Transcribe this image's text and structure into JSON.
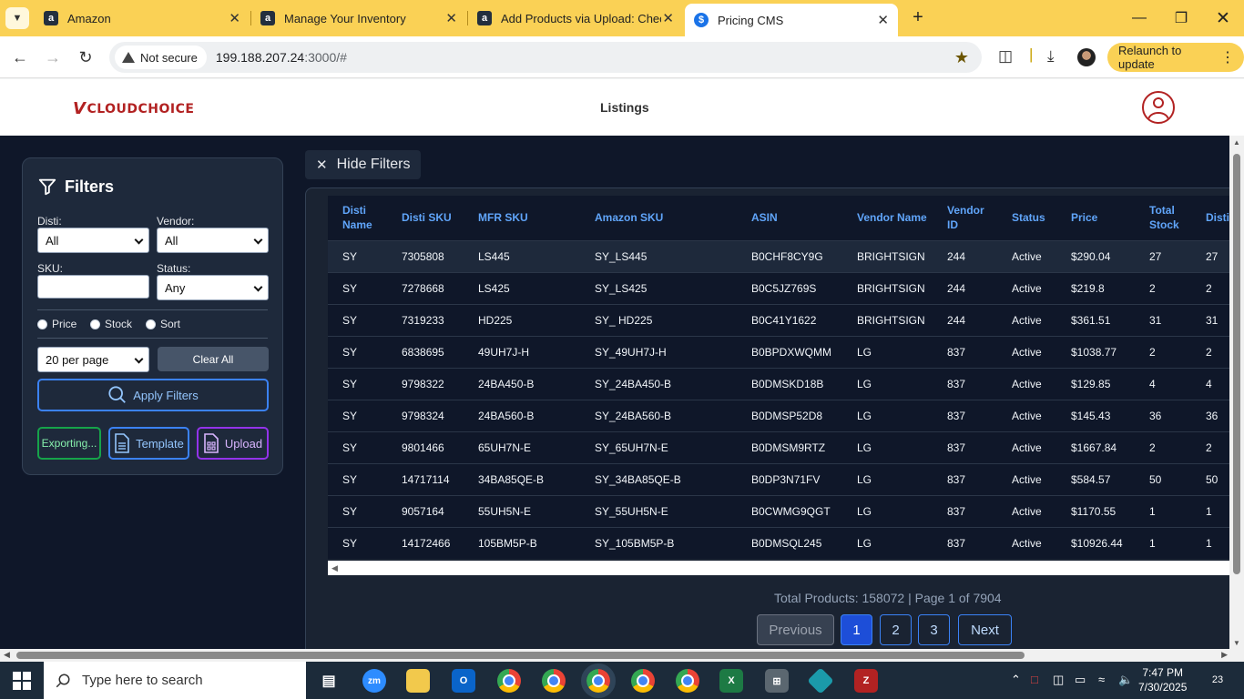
{
  "browser": {
    "tabs": [
      {
        "title": "Amazon"
      },
      {
        "title": "Manage Your Inventory"
      },
      {
        "title": "Add Products via Upload: Check"
      },
      {
        "title": "Pricing CMS"
      }
    ],
    "security_label": "Not secure",
    "url_host": "199.188.207.24",
    "url_path": ":3000/#",
    "relaunch_label": "Relaunch to update"
  },
  "header": {
    "logo_text": "CLOUDCHOICE",
    "nav_title": "Listings"
  },
  "filters": {
    "title": "Filters",
    "disti_label": "Disti:",
    "disti_value": "All",
    "vendor_label": "Vendor:",
    "vendor_value": "All",
    "sku_label": "SKU:",
    "status_label": "Status:",
    "status_value": "Any",
    "radio_price": "Price",
    "radio_stock": "Stock",
    "radio_sort": "Sort",
    "per_page_value": "20 per page",
    "clear_all_label": "Clear All",
    "apply_label": "Apply Filters",
    "export_label": "Exporting...",
    "template_label": "Template",
    "upload_label": "Upload"
  },
  "hide_filters_label": "Hide Filters",
  "table": {
    "columns": [
      "Disti Name",
      "Disti SKU",
      "MFR SKU",
      "Amazon SKU",
      "ASIN",
      "Vendor Name",
      "Vendor ID",
      "Status",
      "Price",
      "Total Stock",
      "Disti Stock"
    ],
    "rows": [
      [
        "SY",
        "7305808",
        "LS445",
        "SY_LS445",
        "B0CHF8CY9G",
        "BRIGHTSIGN",
        "244",
        "Active",
        "$290.04",
        "27",
        "27"
      ],
      [
        "SY",
        "7278668",
        "LS425",
        "SY_LS425",
        "B0C5JZ769S",
        "BRIGHTSIGN",
        "244",
        "Active",
        "$219.8",
        "2",
        "2"
      ],
      [
        "SY",
        "7319233",
        "HD225",
        "SY_ HD225",
        "B0C41Y1622",
        "BRIGHTSIGN",
        "244",
        "Active",
        "$361.51",
        "31",
        "31"
      ],
      [
        "SY",
        "6838695",
        "49UH7J-H",
        "SY_49UH7J-H",
        "B0BPDXWQMM",
        "LG",
        "837",
        "Active",
        "$1038.77",
        "2",
        "2"
      ],
      [
        "SY",
        "9798322",
        "24BA450-B",
        "SY_24BA450-B",
        "B0DMSKD18B",
        "LG",
        "837",
        "Active",
        "$129.85",
        "4",
        "4"
      ],
      [
        "SY",
        "9798324",
        "24BA560-B",
        "SY_24BA560-B",
        "B0DMSP52D8",
        "LG",
        "837",
        "Active",
        "$145.43",
        "36",
        "36"
      ],
      [
        "SY",
        "9801466",
        "65UH7N-E",
        "SY_65UH7N-E",
        "B0DMSM9RTZ",
        "LG",
        "837",
        "Active",
        "$1667.84",
        "2",
        "2"
      ],
      [
        "SY",
        "14717114",
        "34BA85QE-B",
        "SY_34BA85QE-B",
        "B0DP3N71FV",
        "LG",
        "837",
        "Active",
        "$584.57",
        "50",
        "50"
      ],
      [
        "SY",
        "9057164",
        "55UH5N-E",
        "SY_55UH5N-E",
        "B0CWMG9QGT",
        "LG",
        "837",
        "Active",
        "$1170.55",
        "1",
        "1"
      ],
      [
        "SY",
        "14172466",
        "105BM5P-B",
        "SY_105BM5P-B",
        "B0DMSQL245",
        "LG",
        "837",
        "Active",
        "$10926.44",
        "1",
        "1"
      ]
    ]
  },
  "pagination": {
    "summary": "Total Products: 158072 | Page 1 of 7904",
    "previous_label": "Previous",
    "pages": [
      "1",
      "2",
      "3"
    ],
    "next_label": "Next"
  },
  "taskbar": {
    "search_placeholder": "Type here to search",
    "time": "7:47 PM",
    "date": "7/30/2025",
    "notification_count": "23"
  }
}
